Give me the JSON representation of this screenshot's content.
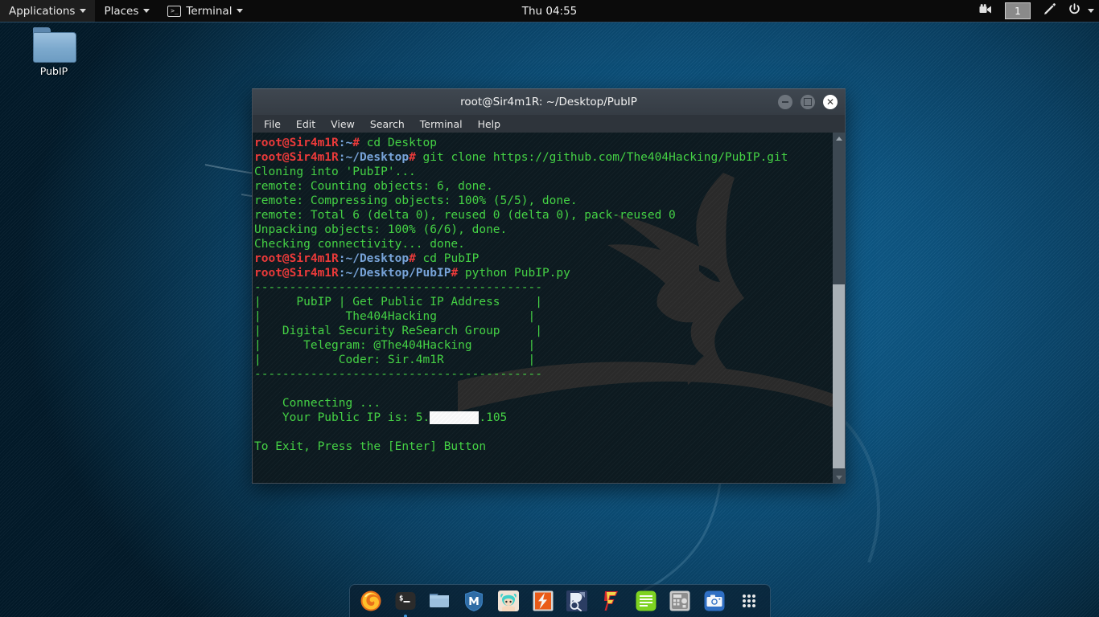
{
  "panel": {
    "applications_label": "Applications",
    "places_label": "Places",
    "terminal_label": "Terminal",
    "terminal_icon": "terminal-icon",
    "clock": "Thu 04:55",
    "workspace": "1",
    "tray": [
      {
        "name": "video-camera-icon"
      },
      {
        "name": "pen-icon"
      },
      {
        "name": "power-icon"
      }
    ]
  },
  "desktop": {
    "icons": [
      {
        "label": "PubIP",
        "icon": "folder-icon"
      }
    ]
  },
  "window": {
    "title": "root@Sir4m1R: ~/Desktop/PubIP",
    "controls": {
      "minimize": "minimize-button",
      "maximize": "maximize-button",
      "close": "close-button"
    },
    "menus": [
      "File",
      "Edit",
      "View",
      "Search",
      "Terminal",
      "Help"
    ]
  },
  "terminal": {
    "prompt_user": "root@Sir4m1R",
    "lines": [
      {
        "type": "prompt",
        "user": "root@Sir4m1R",
        "sep": ":",
        "path": "~",
        "hash": "# ",
        "cmd": "cd Desktop"
      },
      {
        "type": "prompt",
        "user": "root@Sir4m1R",
        "sep": ":~/",
        "path": "Desktop",
        "hash": "# ",
        "cmd": "git clone https://github.com/The404Hacking/PubIP.git"
      },
      {
        "type": "out",
        "text": "Cloning into 'PubIP'..."
      },
      {
        "type": "out",
        "text": "remote: Counting objects: 6, done."
      },
      {
        "type": "out",
        "text": "remote: Compressing objects: 100% (5/5), done."
      },
      {
        "type": "out",
        "text": "remote: Total 6 (delta 0), reused 0 (delta 0), pack-reused 0"
      },
      {
        "type": "out",
        "text": "Unpacking objects: 100% (6/6), done."
      },
      {
        "type": "out",
        "text": "Checking connectivity... done."
      },
      {
        "type": "prompt",
        "user": "root@Sir4m1R",
        "sep": ":~/",
        "path": "Desktop",
        "hash": "# ",
        "cmd": "cd PubIP"
      },
      {
        "type": "prompt",
        "user": "root@Sir4m1R",
        "sep": ":~/",
        "path": "Desktop/PubIP",
        "hash": "# ",
        "cmd": "python PubIP.py"
      },
      {
        "type": "out",
        "text": "-----------------------------------------"
      },
      {
        "type": "out",
        "text": "|     PubIP | Get Public IP Address     |"
      },
      {
        "type": "out",
        "text": "|            The404Hacking             |"
      },
      {
        "type": "out",
        "text": "|   Digital Security ReSearch Group     |"
      },
      {
        "type": "out",
        "text": "|      Telegram: @The404Hacking        |"
      },
      {
        "type": "out",
        "text": "|           Coder: Sir.4m1R            |"
      },
      {
        "type": "out",
        "text": "-----------------------------------------"
      },
      {
        "type": "out",
        "text": ""
      },
      {
        "type": "out",
        "text": "    Connecting ..."
      },
      {
        "type": "redacted",
        "pre": "    Your Public IP is: 5.",
        "mask": "XXXXXXX",
        "post": ".105"
      },
      {
        "type": "out",
        "text": ""
      },
      {
        "type": "out",
        "text": "To Exit, Press the [Enter] Button"
      }
    ],
    "scrollbar": {
      "up": "scroll-up-arrow",
      "down": "scroll-down-arrow"
    }
  },
  "dock": {
    "items": [
      {
        "name": "firefox-icon",
        "label": "Firefox",
        "active": false
      },
      {
        "name": "terminal-icon",
        "label": "Terminal",
        "active": true
      },
      {
        "name": "files-icon",
        "label": "Files",
        "active": false
      },
      {
        "name": "metasploit-icon",
        "label": "Metasploit",
        "active": false
      },
      {
        "name": "avatar-app-icon",
        "label": "Avatar App",
        "active": false
      },
      {
        "name": "burp-suite-icon",
        "label": "Burp Suite",
        "active": false
      },
      {
        "name": "wireshark-icon",
        "label": "Wireshark",
        "active": false
      },
      {
        "name": "faraday-icon",
        "label": "Faraday",
        "active": false
      },
      {
        "name": "text-editor-icon",
        "label": "Text Editor",
        "active": false
      },
      {
        "name": "calculator-icon",
        "label": "Calculator",
        "active": false
      },
      {
        "name": "screenshot-icon",
        "label": "Screenshot",
        "active": false
      },
      {
        "name": "app-grid-icon",
        "label": "Show Applications",
        "active": false
      }
    ]
  },
  "colors": {
    "terminal_bg": "#0d1b21",
    "terminal_green": "#45d645",
    "prompt_red": "#f03a3a",
    "prompt_blue": "#7aa7de",
    "wallpaper_blue": "#0d5480",
    "panel_bg": "#0b0b0b"
  }
}
